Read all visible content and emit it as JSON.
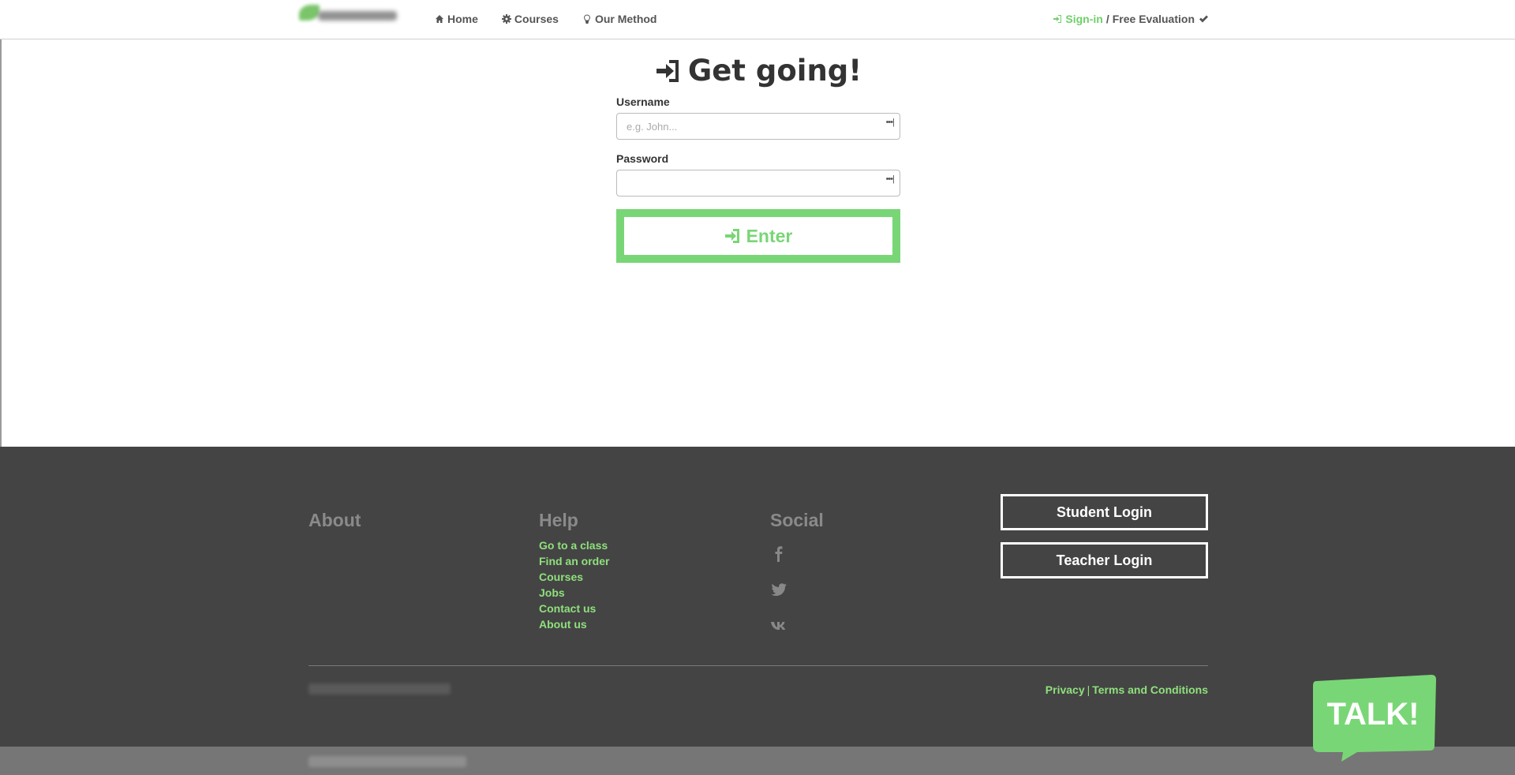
{
  "header": {
    "nav": [
      {
        "icon": "home-icon",
        "label": "Home"
      },
      {
        "icon": "gear-icon",
        "label": "Courses"
      },
      {
        "icon": "lightbulb-icon",
        "label": "Our Method"
      }
    ],
    "signin_label": "Sign-in",
    "separator": "/",
    "evaluation_label": "Free Evaluation"
  },
  "login": {
    "title": "Get going!",
    "username_label": "Username",
    "username_placeholder": "e.g. John...",
    "username_value": "",
    "password_label": "Password",
    "password_value": "",
    "dots_indicator": "•••|",
    "enter_label": "Enter"
  },
  "footer": {
    "about_title": "About",
    "help_title": "Help",
    "social_title": "Social",
    "help_links": [
      "Go to a class",
      "Find an order",
      "Courses",
      "Jobs",
      "Contact us",
      "About us"
    ],
    "social_icons": [
      "facebook-icon",
      "twitter-icon",
      "vk-icon"
    ],
    "student_login": "Student Login",
    "teacher_login": "Teacher Login",
    "privacy": "Privacy",
    "legal_separator": "|",
    "terms": "Terms and Conditions"
  },
  "talk_badge": "TALK!",
  "colors": {
    "accent": "#79d676",
    "footer_bg": "#444444",
    "bottom_bar": "#767676"
  }
}
